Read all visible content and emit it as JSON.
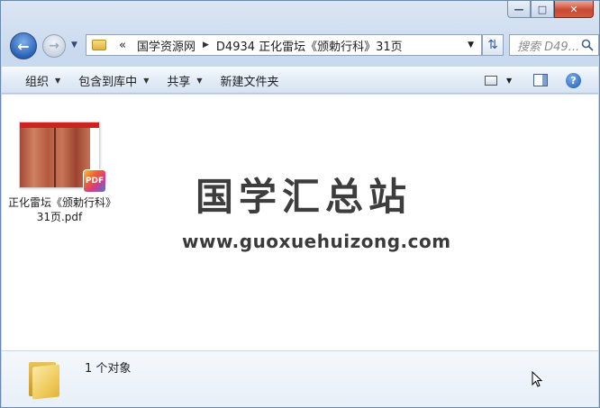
{
  "window": {
    "caption_buttons": {
      "minimize": "—",
      "maximize": "□",
      "close": "✕"
    }
  },
  "nav": {
    "back_icon": "back-arrow-icon",
    "forward_icon": "forward-arrow-icon",
    "address": {
      "overflow": "«",
      "segments": [
        "国学资源网",
        "D4934 正化雷坛《颁勅行科》31页"
      ]
    },
    "search_placeholder": "搜索 D49..."
  },
  "toolbar": {
    "organize": "组织",
    "include_in_library": "包含到库中",
    "share": "共享",
    "new_folder": "新建文件夹"
  },
  "files": [
    {
      "name": "正化雷坛《颁勅行科》31页.pdf",
      "badge": "PDF",
      "type_icon": "pdf-icon"
    }
  ],
  "watermark": {
    "title": "国学汇总站",
    "url": "www.guoxuehuizong.com"
  },
  "details": {
    "status": "1 个对象"
  },
  "colors": {
    "accent": "#2a62b6",
    "close_button": "#c94a33",
    "pdf_band": "#cc2222"
  }
}
